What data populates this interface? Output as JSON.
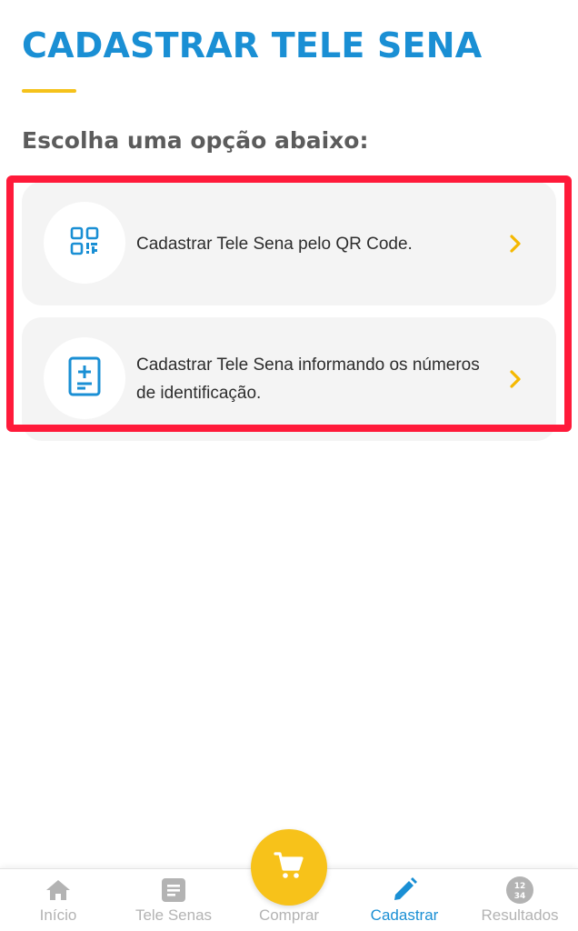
{
  "header": {
    "title": "CADASTRAR TELE SENA",
    "subtitle": "Escolha uma opção abaixo:"
  },
  "options": [
    {
      "label": "Cadastrar Tele Sena pelo QR Code.",
      "icon": "qr-code-icon"
    },
    {
      "label": "Cadastrar Tele Sena informando os números de identificação.",
      "icon": "document-add-icon"
    }
  ],
  "bottom_nav": {
    "items": [
      {
        "label": "Início",
        "icon": "home-icon"
      },
      {
        "label": "Tele Senas",
        "icon": "list-document-icon"
      },
      {
        "label": "Comprar",
        "icon": "cart-icon"
      },
      {
        "label": "Cadastrar",
        "icon": "pencil-icon",
        "active": true
      },
      {
        "label": "Resultados",
        "icon": "numbers-badge-icon",
        "badge_text": "12 34"
      }
    ]
  },
  "colors": {
    "primary_blue": "#1a8fd4",
    "accent_yellow": "#f5c21b",
    "highlight_red": "#ff1a3a",
    "inactive_gray": "#b3b3b3"
  }
}
